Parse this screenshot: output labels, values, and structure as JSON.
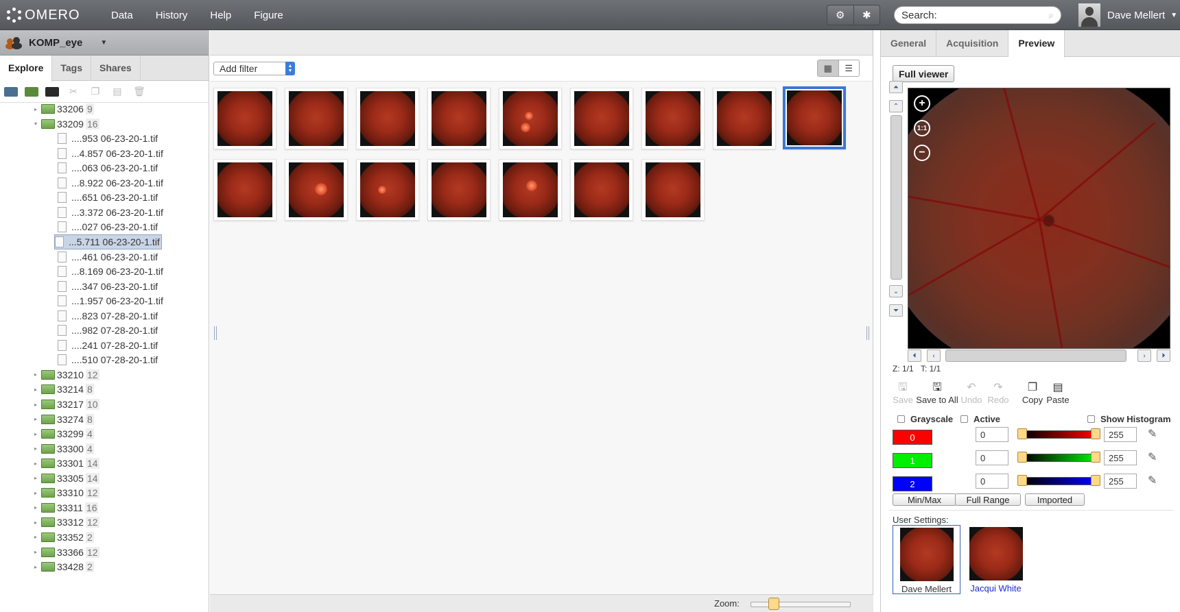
{
  "topbar": {
    "brand": "OMERO",
    "nav": [
      "Data",
      "History",
      "Help",
      "Figure"
    ],
    "search_placeholder": "Search:",
    "user_name": "Dave Mellert",
    "icons": [
      "settings-icon",
      "star-icon"
    ]
  },
  "left": {
    "group_name": "KOMP_eye",
    "tabs": [
      "Explore",
      "Tags",
      "Shares"
    ],
    "active_tab": "Explore",
    "tree": [
      {
        "type": "folder",
        "name": "33206",
        "count": "9",
        "expanded": false
      },
      {
        "type": "folder",
        "name": "33209",
        "count": "16",
        "expanded": true
      },
      {
        "type": "image",
        "name": "....953 06-23-20-1.tif"
      },
      {
        "type": "image",
        "name": "...4.857 06-23-20-1.tif"
      },
      {
        "type": "image",
        "name": "....063 06-23-20-1.tif"
      },
      {
        "type": "image",
        "name": "...8.922 06-23-20-1.tif"
      },
      {
        "type": "image",
        "name": "....651 06-23-20-1.tif"
      },
      {
        "type": "image",
        "name": "...3.372 06-23-20-1.tif"
      },
      {
        "type": "image",
        "name": "....027 06-23-20-1.tif"
      },
      {
        "type": "image",
        "name": "...5.711 06-23-20-1.tif",
        "selected": true
      },
      {
        "type": "image",
        "name": "....461 06-23-20-1.tif"
      },
      {
        "type": "image",
        "name": "...8.169 06-23-20-1.tif"
      },
      {
        "type": "image",
        "name": "....347 06-23-20-1.tif"
      },
      {
        "type": "image",
        "name": "...1.957 06-23-20-1.tif"
      },
      {
        "type": "image",
        "name": "....823 07-28-20-1.tif"
      },
      {
        "type": "image",
        "name": "....982 07-28-20-1.tif"
      },
      {
        "type": "image",
        "name": "....241 07-28-20-1.tif"
      },
      {
        "type": "image",
        "name": "....510 07-28-20-1.tif"
      },
      {
        "type": "folder",
        "name": "33210",
        "count": "12"
      },
      {
        "type": "folder",
        "name": "33214",
        "count": "8"
      },
      {
        "type": "folder",
        "name": "33217",
        "count": "10"
      },
      {
        "type": "folder",
        "name": "33274",
        "count": "8"
      },
      {
        "type": "folder",
        "name": "33299",
        "count": "4"
      },
      {
        "type": "folder",
        "name": "33300",
        "count": "4"
      },
      {
        "type": "folder",
        "name": "33301",
        "count": "14"
      },
      {
        "type": "folder",
        "name": "33305",
        "count": "14"
      },
      {
        "type": "folder",
        "name": "33310",
        "count": "12"
      },
      {
        "type": "folder",
        "name": "33311",
        "count": "16"
      },
      {
        "type": "folder",
        "name": "33312",
        "count": "12"
      },
      {
        "type": "folder",
        "name": "33352",
        "count": "2"
      },
      {
        "type": "folder",
        "name": "33366",
        "count": "12"
      },
      {
        "type": "folder",
        "name": "33428",
        "count": "2"
      }
    ]
  },
  "center": {
    "filter_label": "Add filter",
    "zoom_label": "Zoom:",
    "zoom_level": 0.2,
    "thumbnail_count": 16,
    "selected_thumbnail": 8
  },
  "right": {
    "tabs": [
      "General",
      "Acquisition",
      "Preview"
    ],
    "active_tab": "Preview",
    "full_viewer": "Full viewer",
    "z_label": "Z: 1/1",
    "t_label": "T: 1/1",
    "tools": [
      {
        "label": "Save",
        "enabled": false
      },
      {
        "label": "Save to All",
        "enabled": true
      },
      {
        "label": "Undo",
        "enabled": false
      },
      {
        "label": "Redo",
        "enabled": false
      },
      {
        "label": "Copy",
        "enabled": true
      },
      {
        "label": "Paste",
        "enabled": true
      }
    ],
    "grayscale_label": "Grayscale",
    "active_label": "Active",
    "histogram_label": "Show Histogram",
    "channels": [
      {
        "label": "0",
        "color": "#ff0000",
        "min": "0",
        "max": "255"
      },
      {
        "label": "1",
        "color": "#00ee00",
        "min": "0",
        "max": "255"
      },
      {
        "label": "2",
        "color": "#0000ff",
        "min": "0",
        "max": "255"
      }
    ],
    "range_buttons": [
      "Min/Max",
      "Full Range",
      "Imported"
    ],
    "user_settings_label": "User Settings:",
    "user_settings": [
      {
        "name": "Dave Mellert",
        "active": true
      },
      {
        "name": "Jacqui White",
        "active": false
      }
    ]
  }
}
